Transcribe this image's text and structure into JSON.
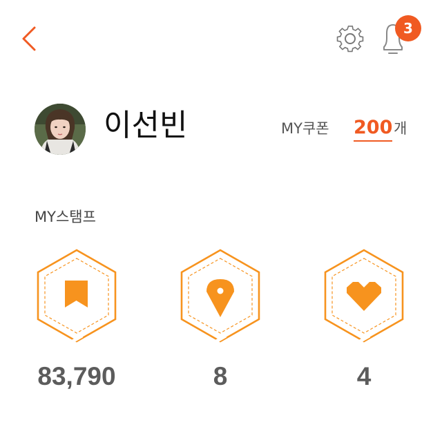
{
  "header": {
    "notification_count": "3"
  },
  "profile": {
    "name": "이선빈",
    "coupon_label": "MY쿠폰",
    "coupon_count": "200",
    "coupon_unit": "개"
  },
  "stamps": {
    "title": "MY스탬프",
    "items": [
      {
        "icon": "bookmark-icon",
        "value": "83,790"
      },
      {
        "icon": "location-pin-icon",
        "value": "8"
      },
      {
        "icon": "heart-icon",
        "value": "4"
      }
    ]
  },
  "colors": {
    "accent": "#f05a22",
    "stamp_orange": "#f7931e",
    "value_gray": "#5c5c5c"
  }
}
